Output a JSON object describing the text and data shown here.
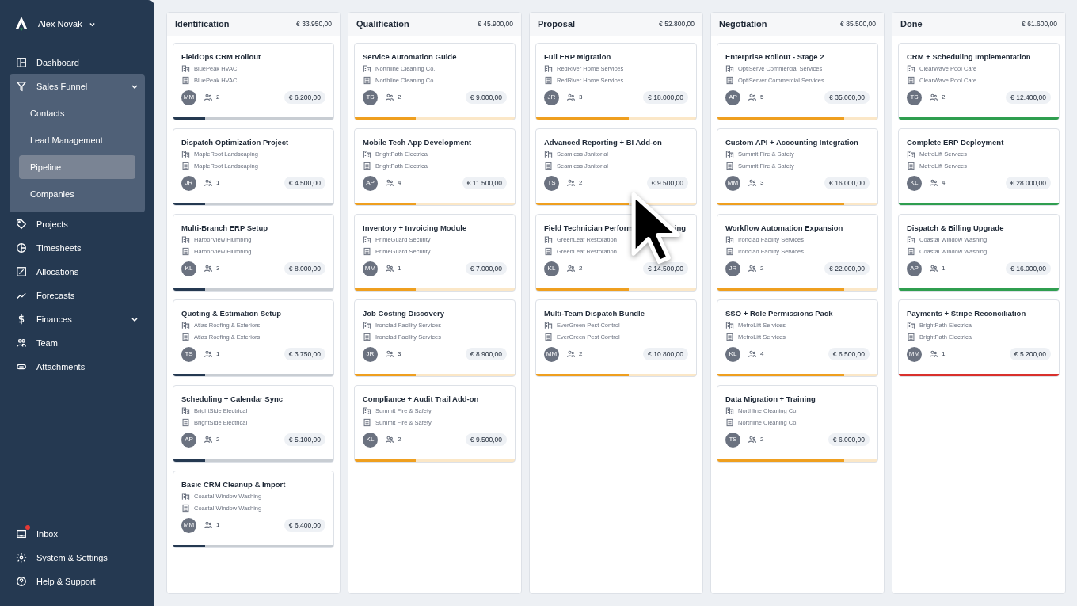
{
  "user": {
    "name": "Alex Novak"
  },
  "nav": [
    {
      "label": "Dashboard",
      "selected": false
    },
    {
      "label": "Sales Funnel",
      "selected": false,
      "expanded": true,
      "children": [
        {
          "label": "Contacts",
          "selected": false
        },
        {
          "label": "Lead Management",
          "selected": false
        },
        {
          "label": "Pipeline",
          "selected": true
        },
        {
          "label": "Companies",
          "selected": false
        }
      ]
    },
    {
      "label": "Projects",
      "selected": false
    },
    {
      "label": "Timesheets",
      "selected": false
    },
    {
      "label": "Allocations",
      "selected": false
    },
    {
      "label": "Forecasts",
      "selected": false
    },
    {
      "label": "Finances",
      "selected": false,
      "expanded": false
    },
    {
      "label": "Team",
      "selected": false
    },
    {
      "label": "Attachments",
      "selected": false
    }
  ],
  "bottom_nav": [
    {
      "label": "Inbox",
      "unread": true
    },
    {
      "label": "System & Settings",
      "unread": false
    },
    {
      "label": "Help & Support",
      "unread": false
    }
  ],
  "columns": [
    {
      "title": "Identification",
      "total": "€ 33.950,00",
      "color": "#253951",
      "cards": [
        {
          "title": "FieldOps CRM Rollout",
          "company": "BluePeak HVAC",
          "contact": "BluePeak HVAC",
          "owner": "MM",
          "people": "2",
          "amount": "€ 6.200,00",
          "level": 0.2
        },
        {
          "title": "Dispatch Optimization Project",
          "company": "MapleRoot Landscaping",
          "contact": "MapleRoot Landscaping",
          "owner": "JR",
          "people": "1",
          "amount": "€ 4.500,00",
          "level": 0.2
        },
        {
          "title": "Multi-Branch ERP Setup",
          "company": "HarborView Plumbing",
          "contact": "HarborView Plumbing",
          "owner": "KL",
          "people": "3",
          "amount": "€ 8.000,00",
          "level": 0.2
        },
        {
          "title": "Quoting & Estimation Setup",
          "company": "Atlas Roofing & Exteriors",
          "contact": "Atlas Roofing & Exteriors",
          "owner": "TS",
          "people": "1",
          "amount": "€ 3.750,00",
          "level": 0.2
        },
        {
          "title": "Scheduling + Calendar Sync",
          "company": "BrightSide Electrical",
          "contact": "BrightSide Electrical",
          "owner": "AP",
          "people": "2",
          "amount": "€ 5.100,00",
          "level": 0.2
        },
        {
          "title": "Basic CRM Cleanup & Import",
          "company": "Coastal Window Washing",
          "contact": "Coastal Window Washing",
          "owner": "MM",
          "people": "1",
          "amount": "€ 6.400,00",
          "level": 0.2
        }
      ]
    },
    {
      "title": "Qualification",
      "total": "€ 45.900,00",
      "color": "#ef9f1f",
      "cards": [
        {
          "title": "Service Automation Guide",
          "company": "Northline Cleaning Co.",
          "contact": "Northline Cleaning Co.",
          "owner": "TS",
          "people": "2",
          "amount": "€ 9.000,00",
          "level": 0.38
        },
        {
          "title": "Mobile Tech App Development",
          "company": "BrightPath Electrical",
          "contact": "BrightPath Electrical",
          "owner": "AP",
          "people": "4",
          "amount": "€ 11.500,00",
          "level": 0.38
        },
        {
          "title": "Inventory + Invoicing Module",
          "company": "PrimeGuard Security",
          "contact": "PrimeGuard Security",
          "owner": "MM",
          "people": "1",
          "amount": "€ 7.000,00",
          "level": 0.38
        },
        {
          "title": "Job Costing Discovery",
          "company": "Ironclad Facility Services",
          "contact": "Ironclad Facility Services",
          "owner": "JR",
          "people": "3",
          "amount": "€ 8.900,00",
          "level": 0.38
        },
        {
          "title": "Compliance + Audit Trail Add-on",
          "company": "Summit Fire & Safety",
          "contact": "Summit Fire & Safety",
          "owner": "KL",
          "people": "2",
          "amount": "€ 9.500,00",
          "level": 0.38
        }
      ]
    },
    {
      "title": "Proposal",
      "total": "€ 52.800,00",
      "color": "#ef9f1f",
      "cards": [
        {
          "title": "Full ERP Migration",
          "company": "RedRiver Home Services",
          "contact": "RedRiver Home Services",
          "owner": "JR",
          "people": "3",
          "amount": "€ 18.000,00",
          "level": 0.58
        },
        {
          "title": "Advanced Reporting + BI Add-on",
          "company": "Seamless Janitorial",
          "contact": "Seamless Janitorial",
          "owner": "TS",
          "people": "2",
          "amount": "€ 9.500,00",
          "level": 0.58
        },
        {
          "title": "Field Technician Perform",
          "title_tail": "ing",
          "company": "GreenLeaf Restoration",
          "contact": "GreenLeaf Restoration",
          "owner": "KL",
          "people": "2",
          "amount": "€ 14.500,00",
          "level": 0.58
        },
        {
          "title": "Multi-Team Dispatch Bundle",
          "company": "EverGreen Pest Control",
          "contact": "EverGreen Pest Control",
          "owner": "MM",
          "people": "2",
          "amount": "€ 10.800,00",
          "level": 0.58
        }
      ]
    },
    {
      "title": "Negotiation",
      "total": "€ 85.500,00",
      "color": "#ef9f1f",
      "cards": [
        {
          "title": "Enterprise Rollout - Stage 2",
          "company": "OptiServe Commercial Services",
          "contact": "OptiServer Commercial Services",
          "owner": "AP",
          "people": "5",
          "amount": "€ 35.000,00",
          "level": 0.79
        },
        {
          "title": "Custom API + Accounting Integration",
          "company": "Summit Fire & Safety",
          "contact": "Summit Fire & Safety",
          "owner": "MM",
          "people": "3",
          "amount": "€ 16.000,00",
          "level": 0.79
        },
        {
          "title": "Workflow Automation Expansion",
          "company": "Ironclad Facility Services",
          "contact": "Ironclad Facility Services",
          "owner": "JR",
          "people": "2",
          "amount": "€ 22.000,00",
          "level": 0.79
        },
        {
          "title": "SSO + Role Permissions Pack",
          "company": "MetroLift Services",
          "contact": "MetroLift Services",
          "owner": "KL",
          "people": "4",
          "amount": "€ 6.500,00",
          "level": 0.79
        },
        {
          "title": "Data Migration + Training",
          "company": "Northline Cleaning Co.",
          "contact": "Northline Cleaning Co.",
          "owner": "TS",
          "people": "2",
          "amount": "€ 6.000,00",
          "level": 0.79
        }
      ]
    },
    {
      "title": "Done",
      "total": "€ 61.600,00",
      "cards": [
        {
          "title": "CRM + Scheduling Implementation",
          "company": "ClearWave Pool Care",
          "contact": "ClearWave Pool Care",
          "owner": "TS",
          "people": "2",
          "amount": "€ 12.400,00",
          "level": 1,
          "color": "#2f9e4f"
        },
        {
          "title": "Complete ERP Deployment",
          "company": "MetroLift Services",
          "contact": "MetroLift Services",
          "owner": "KL",
          "people": "4",
          "amount": "€ 28.000,00",
          "level": 1,
          "color": "#2f9e4f"
        },
        {
          "title": "Dispatch & Billing Upgrade",
          "company": "Coastal Window Washing",
          "contact": "Coastal Window Washing",
          "owner": "AP",
          "people": "1",
          "amount": "€ 16.000,00",
          "level": 1,
          "color": "#2f9e4f"
        },
        {
          "title": "Payments + Stripe Reconciliation",
          "company": "BrightPath Electrical",
          "contact": "BrightPath Electrical",
          "owner": "MM",
          "people": "1",
          "amount": "€ 5.200,00",
          "level": 1,
          "color": "#d9302c"
        }
      ]
    }
  ]
}
